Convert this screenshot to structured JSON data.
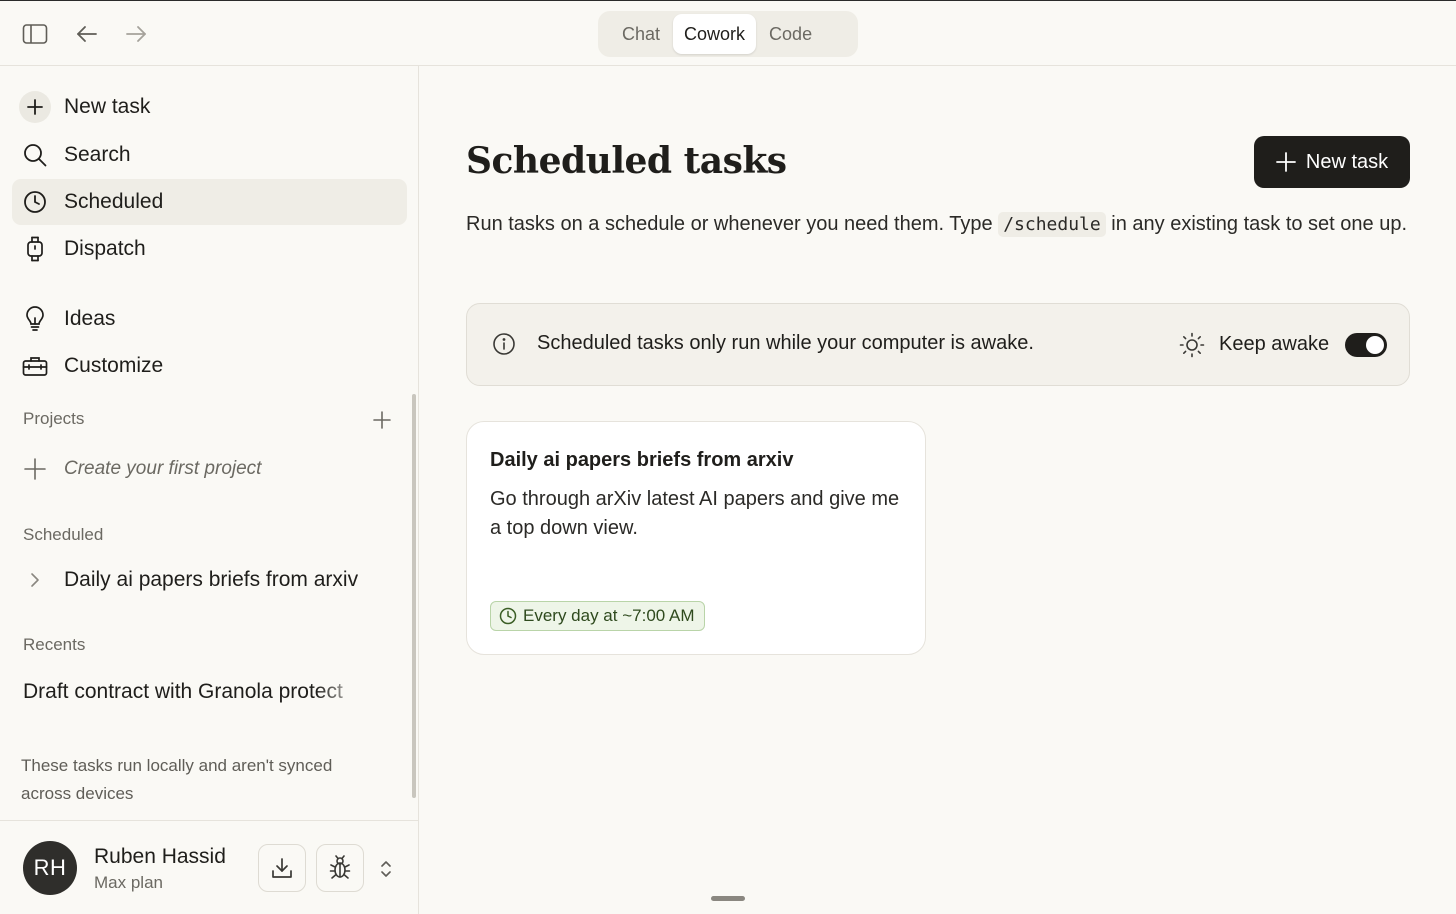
{
  "topbar": {
    "tabs": [
      {
        "label": "Chat",
        "active": false
      },
      {
        "label": "Cowork",
        "active": true
      },
      {
        "label": "Code",
        "active": false
      }
    ],
    "icons": [
      "sidebar-toggle-icon",
      "back-arrow-icon",
      "forward-arrow-icon"
    ]
  },
  "sidebar": {
    "nav": [
      {
        "label": "New task",
        "icon": "plus-icon"
      },
      {
        "label": "Search",
        "icon": "search-icon"
      },
      {
        "label": "Scheduled",
        "icon": "clock-icon",
        "active": true
      },
      {
        "label": "Dispatch",
        "icon": "watch-icon"
      },
      {
        "label": "Ideas",
        "icon": "lightbulb-icon"
      },
      {
        "label": "Customize",
        "icon": "toolbox-icon"
      }
    ],
    "projects_label": "Projects",
    "create_project": "Create your first project",
    "scheduled_label": "Scheduled",
    "scheduled_items": [
      "Daily ai papers briefs from arxiv"
    ],
    "recents_label": "Recents",
    "recents": [
      "Draft contract with Granola protect"
    ],
    "local_note": "These tasks run locally and aren't synced across devices",
    "user": {
      "initials": "RH",
      "name": "Ruben Hassid",
      "plan": "Max plan"
    }
  },
  "main": {
    "title": "Scheduled tasks",
    "new_task_label": "New task",
    "description_before": "Run tasks on a schedule or whenever you need them. Type ",
    "description_code": "/schedule",
    "description_after": " in any existing task to set one up.",
    "banner": {
      "text": "Scheduled tasks only run while your computer is awake.",
      "keep_awake_label": "Keep awake",
      "keep_awake_on": true
    },
    "tasks": [
      {
        "title": "Daily ai papers briefs from arxiv",
        "description": "Go through arXiv latest AI papers and give me a top down view.",
        "schedule": "Every day at ~7:00 AM"
      }
    ]
  },
  "colors": {
    "background": "#faf9f5",
    "accent_dark": "#1f1e1b",
    "badge_green_bg": "#eef5e8",
    "badge_green_text": "#2f4a1e"
  }
}
